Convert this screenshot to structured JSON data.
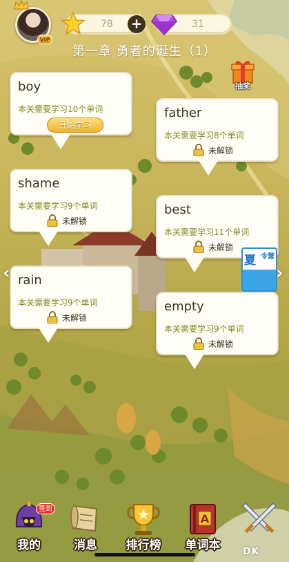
{
  "header": {
    "stars_count": "78",
    "gems_count": "31",
    "vip_label": "VIP",
    "plus_symbol": "+"
  },
  "chapter_title": "第一章 勇者的诞生（1）",
  "lottery_label": "抽奖",
  "levels": [
    {
      "word": "boy",
      "subtitle": "本关需要学习10个单词",
      "action": "开始学习",
      "locked": false
    },
    {
      "word": "father",
      "subtitle": "本关需要学习8个单词",
      "lock_text": "未解锁",
      "locked": true
    },
    {
      "word": "shame",
      "subtitle": "本关需要学习9个单词",
      "lock_text": "未解锁",
      "locked": true
    },
    {
      "word": "best",
      "subtitle": "本关需要学习11个单词",
      "lock_text": "未解锁",
      "locked": true
    },
    {
      "word": "rain",
      "subtitle": "本关需要学习9个单词",
      "lock_text": "未解锁",
      "locked": true
    },
    {
      "word": "empty",
      "subtitle": "本关需要学习9个单词",
      "lock_text": "未解锁",
      "locked": true
    }
  ],
  "summer_banner": {
    "big": "夏",
    "small": "令营"
  },
  "nav": [
    {
      "label": "我的",
      "icon": "helmet-icon",
      "badge": "签到"
    },
    {
      "label": "消息",
      "icon": "scroll-icon"
    },
    {
      "label": "排行榜",
      "icon": "trophy-icon"
    },
    {
      "label": "单词本",
      "icon": "book-icon"
    },
    {
      "label": "",
      "icon": "crossed-swords-icon"
    }
  ],
  "watermark": "DK",
  "colors": {
    "accent_gold": "#f0b52e",
    "subtitle_green": "#7a8a1f",
    "badge_red": "#e0332b"
  }
}
